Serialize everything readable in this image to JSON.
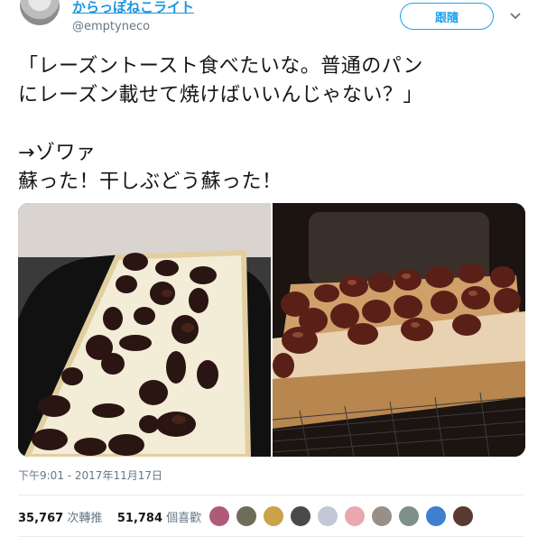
{
  "user": {
    "display_name": "からっぽねこライト",
    "handle": "@emptyneco"
  },
  "follow_button": {
    "label": "跟隨"
  },
  "tweet": {
    "text": "「レーズントースト食べたいな。普通のパン\nにレーズン載せて焼けばいいんじゃない？」\n\n→ゾワァ\n蘇った！干しぶどう蘇った！"
  },
  "timestamp": "下午9:01 - 2017年11月17日",
  "stats": {
    "retweets_count": "35,767",
    "retweets_label": "次轉推",
    "likes_count": "51,784",
    "likes_label": "個喜歡"
  },
  "colors": {
    "accent": "#1da1f2",
    "name_link": "#1b95e0",
    "muted_text": "#657786"
  },
  "likers": [
    {
      "color": "#b05a7a"
    },
    {
      "color": "#6d6d5a"
    },
    {
      "color": "#c9a24a"
    },
    {
      "color": "#4a4a4a"
    },
    {
      "color": "#c2c8d8"
    },
    {
      "color": "#e9a7b0"
    },
    {
      "color": "#9a8f86"
    },
    {
      "color": "#7f8f8a"
    },
    {
      "color": "#3e7fd0"
    },
    {
      "color": "#5a3a32"
    }
  ]
}
